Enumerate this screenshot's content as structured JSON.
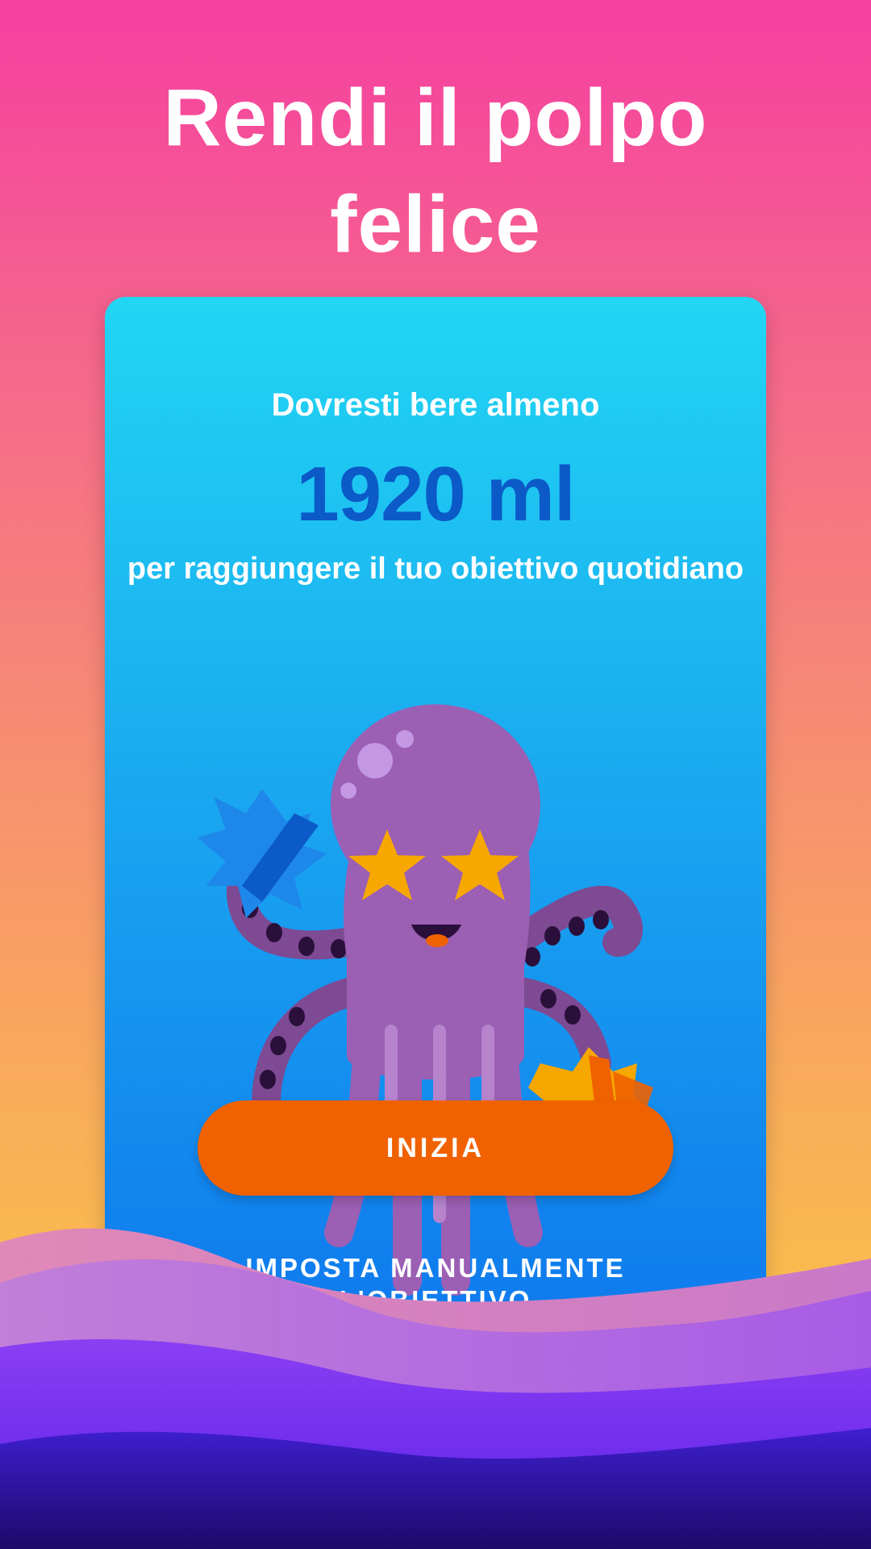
{
  "header": {
    "title_line1": "Rendi il polpo",
    "title_line2": "felice"
  },
  "goal": {
    "prefix": "Dovresti bere almeno",
    "amount": "1920 ml",
    "suffix": "per raggiungere il tuo obiettivo quotidiano"
  },
  "actions": {
    "start_label": "INIZIA",
    "manual_label_line1": "IMPOSTA MANUALMENTE",
    "manual_label_line2": "L'OBIETTIVO"
  },
  "colors": {
    "accent_button": "#f06200",
    "goal_amount": "#0b5ac8",
    "octopus": "#9b5fb4"
  },
  "illustration": {
    "icon": "octopus-with-star-eyes-and-pompoms"
  }
}
